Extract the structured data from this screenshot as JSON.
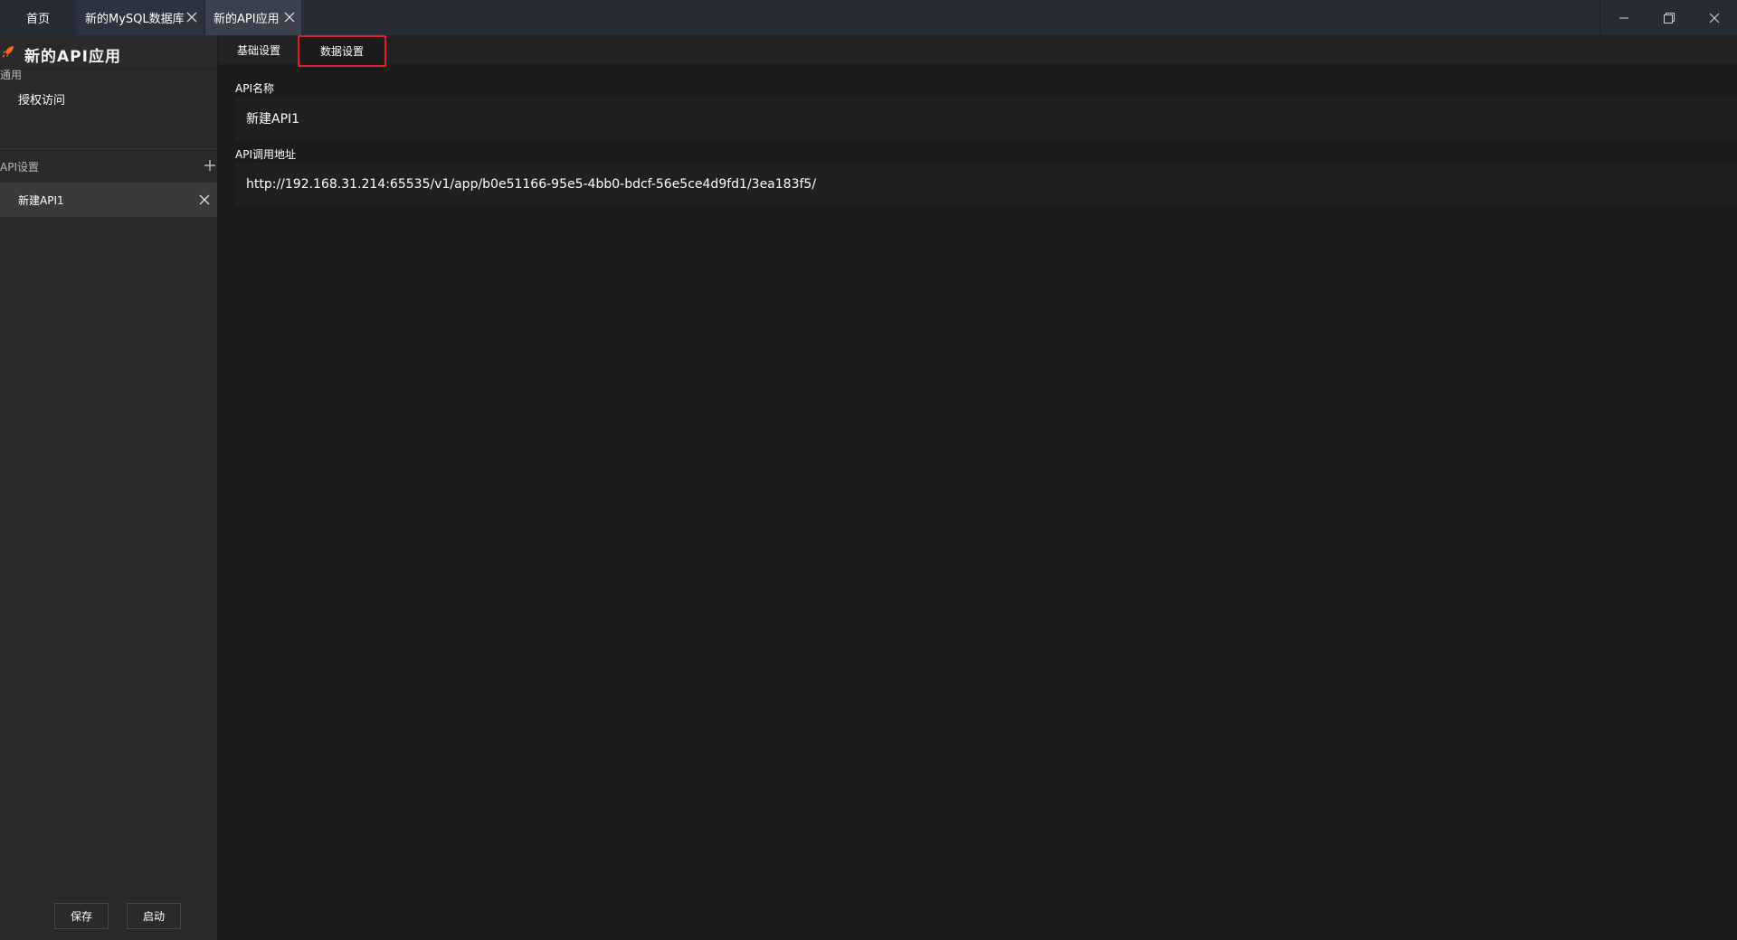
{
  "window_tabs": [
    {
      "label": "首页",
      "closable": false,
      "active": false
    },
    {
      "label": "新的MySQL数据库",
      "closable": true,
      "active": false
    },
    {
      "label": "新的API应用",
      "closable": true,
      "active": true
    }
  ],
  "window_controls": {
    "minimize_icon": "minimize-icon",
    "restore_icon": "restore-icon",
    "close_icon": "close-icon"
  },
  "sidebar": {
    "app_title": "新的API应用",
    "app_icon": "rocket-icon",
    "sections": [
      {
        "label": "通用",
        "items": [
          {
            "label": "授权访问"
          }
        ]
      },
      {
        "label": "API设置",
        "items": [
          {
            "label": "新建API1",
            "selected": true
          }
        ]
      }
    ],
    "buttons": {
      "save": "保存",
      "start": "启动"
    }
  },
  "main": {
    "tabs": [
      {
        "label": "基础设置",
        "active": false
      },
      {
        "label": "数据设置",
        "active": true,
        "highlighted": true
      }
    ],
    "fields": [
      {
        "label": "API名称",
        "value": "新建API1"
      },
      {
        "label": "API调用地址",
        "value": "http://192.168.31.214:65535/v1/app/b0e51166-95e5-4bb0-bdcf-56e5ce4d9fd1/3ea183f5/"
      }
    ]
  },
  "colors": {
    "titlebar_bg": "#262b36",
    "sidebar_bg": "#2a2a2c",
    "main_bg": "#1b1b1c",
    "highlight_border": "#e01f26",
    "accent": "#f26b21"
  }
}
